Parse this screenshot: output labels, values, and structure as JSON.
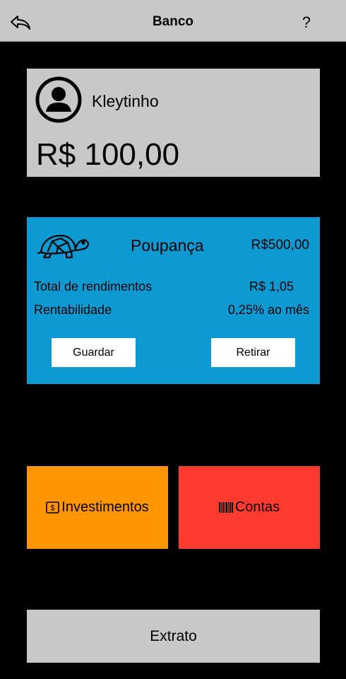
{
  "nav": {
    "title": "Banco",
    "help": "?",
    "back_icon": "back-arrow-icon"
  },
  "profile": {
    "avatar_icon": "user-circle-icon",
    "name": "Kleytinho",
    "balance": "R$ 100,00"
  },
  "savings": {
    "icon": "turtle-icon",
    "title": "Poupança",
    "amount": "R$500,00",
    "rows": [
      {
        "label": "Total de rendimentos",
        "value": "R$ 1,05"
      },
      {
        "label": "Rentabilidade",
        "value": "0,25% ao mês"
      }
    ],
    "save_label": "Guardar",
    "withdraw_label": "Retirar"
  },
  "tiles": {
    "investments_label": "Investimentos",
    "investments_icon": "dollar-bill-icon",
    "bills_label": "Contas",
    "bills_icon": "barcode-icon"
  },
  "statement_label": "Extrato",
  "colors": {
    "background": "#000000",
    "gray_panel": "#c8c8c8",
    "savings_blue": "#0d9ad3",
    "investments_orange": "#ff9500",
    "bills_red": "#ff3b30"
  }
}
